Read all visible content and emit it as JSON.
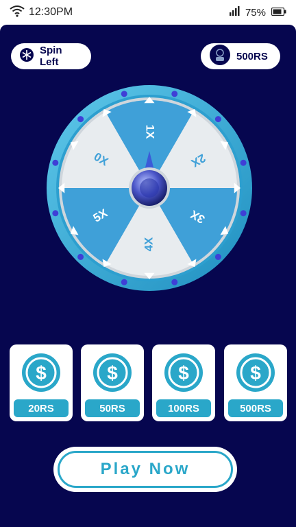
{
  "status_bar": {
    "time": "12:30PM",
    "battery": "75%",
    "icons": [
      "wifi-icon",
      "signal-icon",
      "battery-icon"
    ]
  },
  "header": {
    "spin_label": "Spin Left",
    "spin_icon": "snowflake-icon",
    "balance_label": "500RS",
    "balance_icon": "coin-avatar-icon"
  },
  "wheel": {
    "segments": [
      "1X",
      "2X",
      "3X",
      "4X",
      "5X",
      "0X"
    ]
  },
  "bets": [
    {
      "label": "20RS",
      "icon": "dollar-coin-icon"
    },
    {
      "label": "50RS",
      "icon": "dollar-coin-icon"
    },
    {
      "label": "100RS",
      "icon": "dollar-coin-icon"
    },
    {
      "label": "500RS",
      "icon": "dollar-coin-icon"
    }
  ],
  "play_button": {
    "label": "Play Now"
  },
  "colors": {
    "background": "#06064f",
    "accent": "#2aa7c9",
    "segment_light": "#e8ecef",
    "segment_blue": "#3fa0d8",
    "dot": "#3f3fd6"
  }
}
